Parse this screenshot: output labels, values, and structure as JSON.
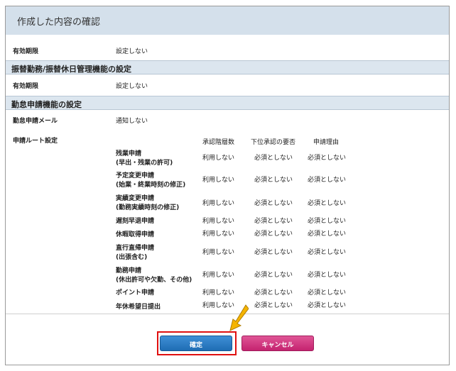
{
  "title": "作成した内容の確認",
  "basic": {
    "label": "有効期限",
    "value": "設定しない"
  },
  "transfer_section": {
    "title": "振替勤務/振替休日管理機能の設定",
    "label": "有効期限",
    "value": "設定しない"
  },
  "attendance_section": {
    "title": "勤怠申請機能の設定",
    "mail_label": "勤怠申請メール",
    "mail_value": "通知しない",
    "route_label": "申請ルート設定",
    "columns": [
      "承認階層数",
      "下位承認の要否",
      "申請理由"
    ],
    "requests": [
      {
        "name1": "残業申請",
        "name2": "(早出・残業の許可)",
        "c1": "利用しない",
        "c2": "必須としない",
        "c3": "必須としない"
      },
      {
        "name1": "予定変更申請",
        "name2": "(始業・終業時刻の修正)",
        "c1": "利用しない",
        "c2": "必須としない",
        "c3": "必須としない"
      },
      {
        "name1": "実績変更申請",
        "name2": "(勤務実績時刻の修正)",
        "c1": "利用しない",
        "c2": "必須としない",
        "c3": "必須としない"
      },
      {
        "name1": "遅刻早退申請",
        "name2": "",
        "c1": "利用しない",
        "c2": "必須としない",
        "c3": "必須としない"
      },
      {
        "name1": "休暇取得申請",
        "name2": "",
        "c1": "利用しない",
        "c2": "必須としない",
        "c3": "必須としない"
      },
      {
        "name1": "直行直帰申請",
        "name2": "(出張含む)",
        "c1": "利用しない",
        "c2": "必須としない",
        "c3": "必須としない"
      },
      {
        "name1": "勤務申請",
        "name2": "(休出許可や欠勤、その他)",
        "c1": "利用しない",
        "c2": "必須としない",
        "c3": "必須としない"
      },
      {
        "name1": "ポイント申請",
        "name2": "",
        "c1": "利用しない",
        "c2": "必須としない",
        "c3": "必須としない"
      },
      {
        "name1": "年休希望日提出",
        "name2": "",
        "c1": "利用しない",
        "c2": "必須としない",
        "c3": "必須としない"
      }
    ]
  },
  "buttons": {
    "confirm": "確定",
    "cancel": "キャンセル"
  },
  "colors": {
    "confirm": "#2a7bc4",
    "cancel": "#d0337f",
    "highlight": "#e01010",
    "arrow": "#f5b400"
  }
}
